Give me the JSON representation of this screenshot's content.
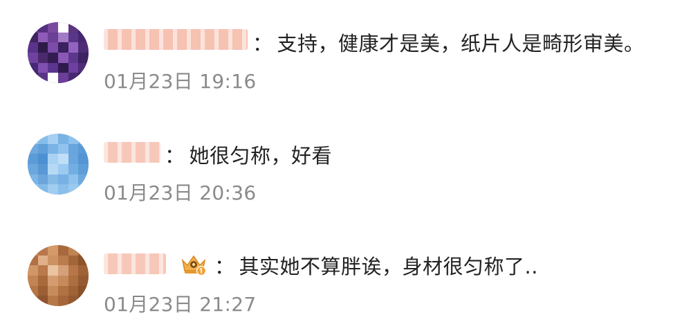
{
  "comments": [
    {
      "separator": "：",
      "text": "支持，健康才是美，纸片人是畸形审美。",
      "time": "01月23日 19:16"
    },
    {
      "separator": "：",
      "text": "她很匀称，好看",
      "time": "01月23日 20:36"
    },
    {
      "separator": "：",
      "text": "其实她不算胖诶，身材很匀称了..",
      "time": "01月23日 21:27",
      "badge_icon": "crown-badge-icon"
    }
  ],
  "colors": {
    "text": "#222222",
    "time": "#8a8a8a",
    "name_blur": "#f4b9a6",
    "badge": "#f0a23a"
  }
}
